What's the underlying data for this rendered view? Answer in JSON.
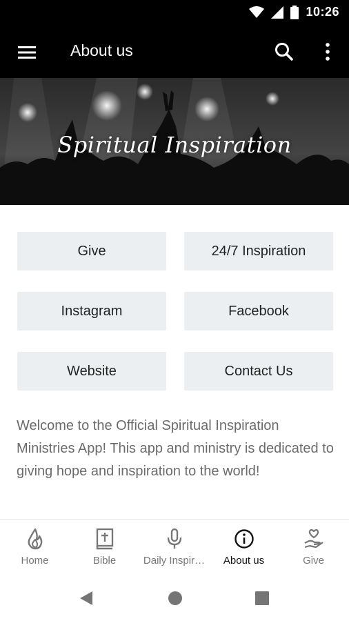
{
  "status_bar": {
    "time": "10:26",
    "icons": [
      "wifi-icon",
      "signal-icon",
      "battery-icon"
    ]
  },
  "app_bar": {
    "title": "About us",
    "icons": [
      "menu-icon",
      "search-icon",
      "more-vert-icon"
    ],
    "background": "#000000"
  },
  "hero": {
    "title": "Spiritual Inspiration"
  },
  "buttons": [
    {
      "label": "Give"
    },
    {
      "label": "24/7 Inspiration"
    },
    {
      "label": "Instagram"
    },
    {
      "label": "Facebook"
    },
    {
      "label": "Website"
    },
    {
      "label": "Contact Us"
    }
  ],
  "welcome_text": "Welcome to the Official Spiritual Inspiration Ministries App!  This app and ministry is dedicated to giving hope and inspiration to the world!",
  "bottom_nav": {
    "items": [
      {
        "label": "Home",
        "icon": "flame-icon"
      },
      {
        "label": "Bible",
        "icon": "bible-icon"
      },
      {
        "label": "Daily Inspir…",
        "icon": "microphone-icon"
      },
      {
        "label": "About us",
        "icon": "info-icon",
        "active": true
      },
      {
        "label": "Give",
        "icon": "heart-hand-icon"
      }
    ]
  },
  "system_nav": {
    "icons": [
      "back-icon",
      "home-icon",
      "recents-icon"
    ]
  },
  "colors": {
    "button_bg": "#eceff1",
    "text_muted": "#6b6b6b",
    "nav_inactive": "#777777",
    "nav_active": "#111111"
  }
}
